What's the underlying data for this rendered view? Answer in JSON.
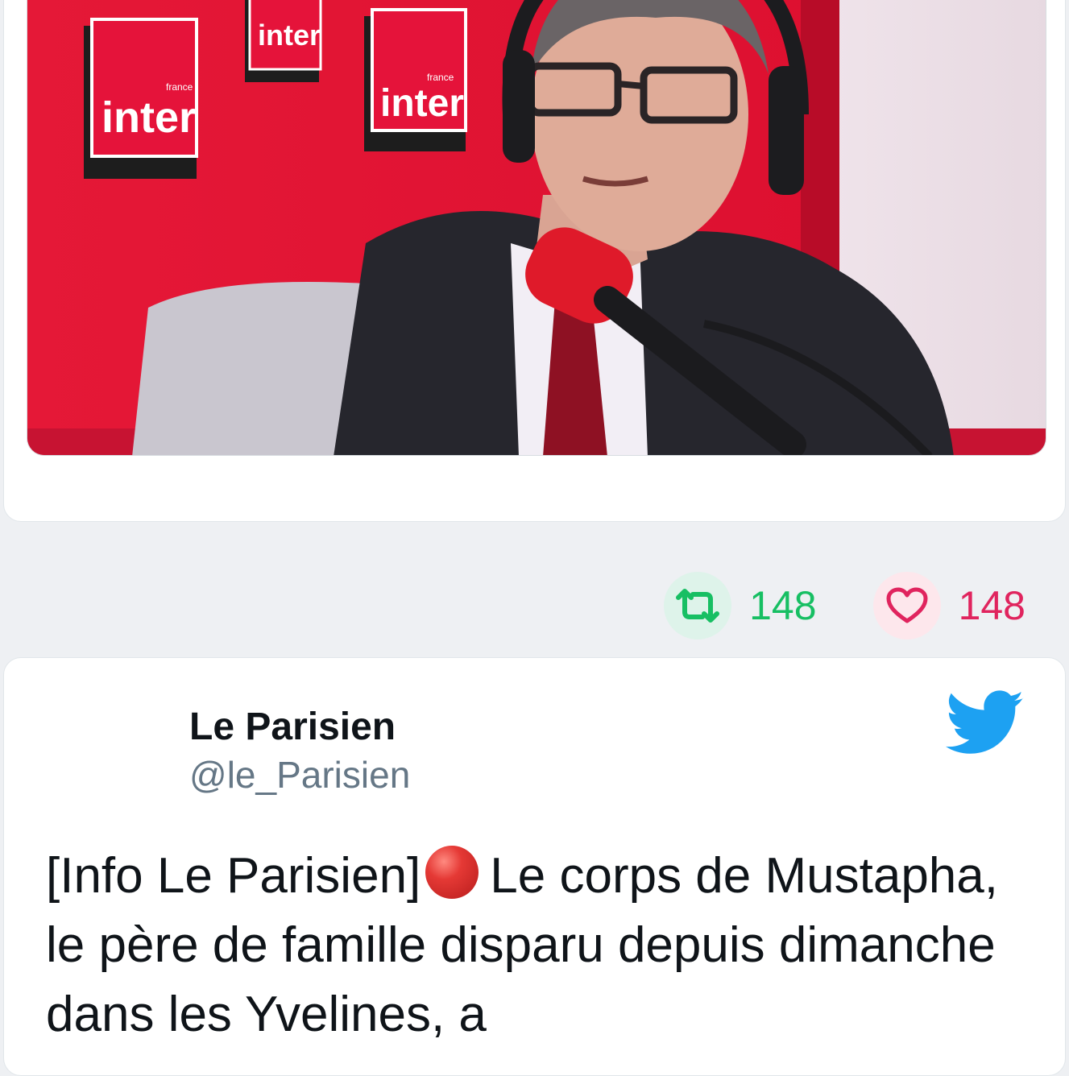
{
  "previous_tweet": {
    "media": {
      "alt_icon": "photo-icon",
      "backdrop_logo_text": "inter",
      "backdrop_logo_small": "france"
    },
    "actions": {
      "retweet_count": "148",
      "like_count": "148"
    }
  },
  "tweet": {
    "author_name": "Le Parisien",
    "author_handle": "@le_Parisien",
    "text_before": "[Info Le Parisien]",
    "text_after": "Le corps de Mustapha, le père de famille disparu depuis dimanche dans les Yvelines, a"
  },
  "colors": {
    "retweet_green": "#17bf63",
    "like_red": "#e0245e",
    "twitter_blue": "#1da1f2",
    "studio_red": "#e0122f"
  }
}
